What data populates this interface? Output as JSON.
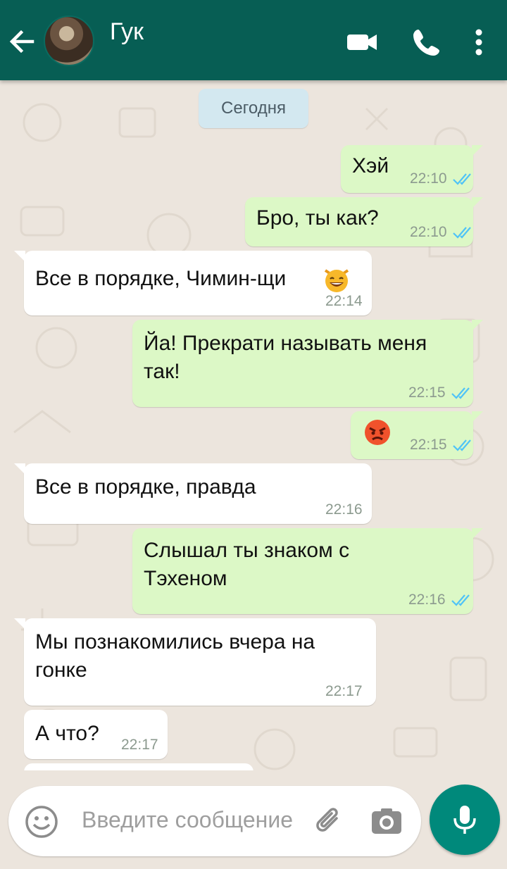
{
  "header": {
    "contact_name": "Гук",
    "bg_color": "#075e54",
    "icons": [
      "back-arrow-icon",
      "avatar",
      "video-call-icon",
      "phone-icon",
      "more-vert-icon"
    ]
  },
  "chat": {
    "date_label": "Сегодня",
    "messages": [
      {
        "dir": "out",
        "text": "Хэй",
        "time": "22:10",
        "status": "read"
      },
      {
        "dir": "out",
        "text": "Бро, ты как?",
        "time": "22:10",
        "status": "read"
      },
      {
        "dir": "in",
        "text": "Все в порядке, Чимин-щи",
        "emoji": "grinning-cat-emoji",
        "time": "22:14"
      },
      {
        "dir": "out",
        "text": "Йа! Прекрати называть меня\nтак!",
        "time": "22:15",
        "status": "read"
      },
      {
        "dir": "out",
        "text": "",
        "emoji": "angry-face-emoji",
        "time": "22:15",
        "status": "read"
      },
      {
        "dir": "in",
        "text": "Все в порядке, правда",
        "time": "22:16"
      },
      {
        "dir": "out",
        "text": "Слышал ты знаком с\nТэхеном",
        "time": "22:16",
        "status": "read"
      },
      {
        "dir": "in",
        "text": "Мы познакомились вчера на\nгонке",
        "time": "22:17"
      },
      {
        "dir": "in",
        "text": "А что?",
        "time": "22:17"
      }
    ]
  },
  "composer": {
    "placeholder": "Введите сообщение",
    "icons": [
      "emoji-icon",
      "attach-icon",
      "camera-icon",
      "mic-icon"
    ],
    "accent_color": "#00897b"
  },
  "colors": {
    "outgoing_bubble": "#dcf8c6",
    "incoming_bubble": "#ffffff",
    "read_ticks": "#4fc3f7"
  }
}
